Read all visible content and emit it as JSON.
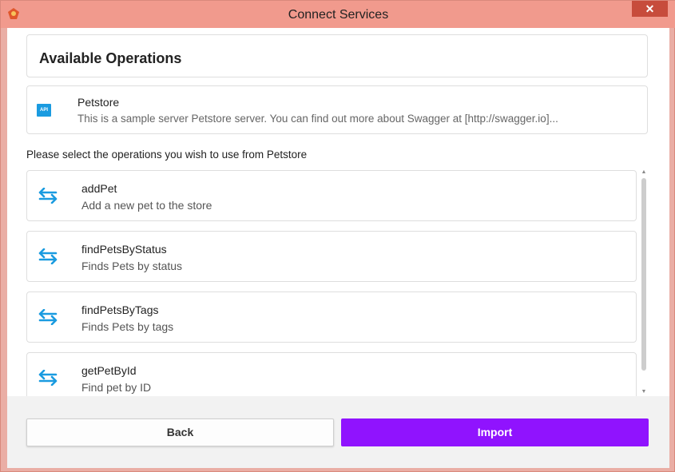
{
  "window": {
    "title": "Connect Services",
    "close_label": "✕",
    "app_icon": "app-logo-icon",
    "close_color": "#c74c3c"
  },
  "header": {
    "title": "Available Operations"
  },
  "service": {
    "badge": "API",
    "name": "Petstore",
    "description": "This is a sample server Petstore server.  You can find out more about Swagger at [http://swagger.io]..."
  },
  "instruction": "Please select the operations you wish to use from Petstore",
  "operations": [
    {
      "name": "addPet",
      "description": "Add a new pet to the store"
    },
    {
      "name": "findPetsByStatus",
      "description": "Finds Pets by status"
    },
    {
      "name": "findPetsByTags",
      "description": "Finds Pets by tags"
    },
    {
      "name": "getPetById",
      "description": "Find pet by ID"
    }
  ],
  "buttons": {
    "back": "Back",
    "import": "Import"
  },
  "colors": {
    "accent": "#9013fe",
    "icon_blue": "#1a9be0"
  }
}
